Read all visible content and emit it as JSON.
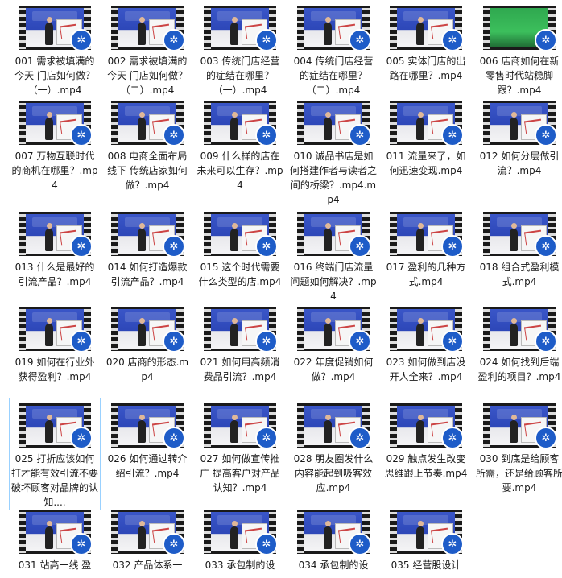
{
  "colors": {
    "selection_border": "#99d1ff",
    "badge": "#1e5cc8",
    "text": "#1a1a1a"
  },
  "badge_icon": "film-reel-icon",
  "files": [
    {
      "name": "001 需求被填满的今天 门店如何做？（一）.mp4"
    },
    {
      "name": "002 需求被填满的今天 门店如何做？（二）.mp4"
    },
    {
      "name": "003 传统门店经营的症结在哪里？（一）.mp4"
    },
    {
      "name": "004 传统门店经营的症结在哪里？（二）.mp4"
    },
    {
      "name": "005 实体门店的出路在哪里？.mp4"
    },
    {
      "name": "006 店商如何在新零售时代站稳脚跟？.mp4"
    },
    {
      "name": "007 万物互联时代的商机在哪里？.mp4"
    },
    {
      "name": "008 电商全面布局线下 传统店家如何做？.mp4"
    },
    {
      "name": "009 什么样的店在未来可以生存？.mp4"
    },
    {
      "name": "010 诚品书店是如何搭建作者与读者之间的桥梁？.mp4.mp4"
    },
    {
      "name": "011 流量来了，如何迅速变现.mp4"
    },
    {
      "name": "012 如何分层做引流？.mp4"
    },
    {
      "name": "013 什么是最好的引流产品？.mp4"
    },
    {
      "name": "014 如何打造爆款引流产品？.mp4"
    },
    {
      "name": "015 这个时代需要什么类型的店.mp4"
    },
    {
      "name": "016 终端门店流量问题如何解决？.mp4"
    },
    {
      "name": "017 盈利的几种方式.mp4"
    },
    {
      "name": "018 组合式盈利模式.mp4"
    },
    {
      "name": "019 如何在行业外获得盈利？.mp4"
    },
    {
      "name": "020 店商的形态.mp4"
    },
    {
      "name": "021 如何用高频消费品引流？.mp4"
    },
    {
      "name": "022 年度促销如何做？.mp4"
    },
    {
      "name": "023 如何做到店没开人全来？.mp4"
    },
    {
      "name": "024 如何找到后端盈利的项目？.mp4"
    },
    {
      "name": "025 打折应该如何打才能有效引流不要破坏顾客对品牌的认知...."
    },
    {
      "name": "026 如何通过转介绍引流？.mp4"
    },
    {
      "name": "027 如何做宣传推广 提高客户对产品认知？.mp4"
    },
    {
      "name": "028 朋友圈发什么内容能起到吸客效应.mp4"
    },
    {
      "name": "029 触点发生改变 思维跟上节奏.mp4"
    },
    {
      "name": "030 到底是给顾客所需，还是给顾客所要.mp4"
    },
    {
      "name": "031 站高一线 盈"
    },
    {
      "name": "032 产品体系一"
    },
    {
      "name": "033 承包制的设"
    },
    {
      "name": "034 承包制的设"
    },
    {
      "name": "035 经营股设计"
    }
  ]
}
